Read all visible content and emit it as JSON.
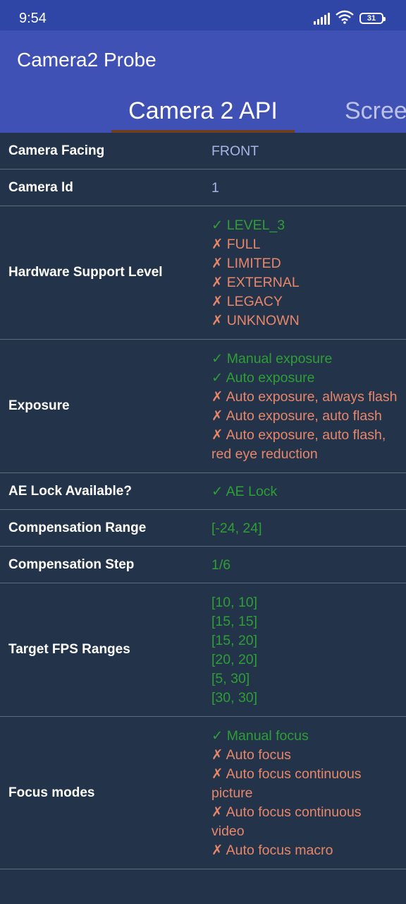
{
  "status_bar": {
    "time": "9:54",
    "battery": "31"
  },
  "app_bar": {
    "title": "Camera2 Probe"
  },
  "tabs": {
    "active": "Camera 2 API",
    "next": "Scree"
  },
  "colors": {
    "status_bar": "#2F46A6",
    "app_bar": "#3F51B5",
    "background": "#23344A",
    "supported": "#2E9E35",
    "unsupported": "#E8866A",
    "neutral_value": "#A8B4E6",
    "tab_indicator": "#6E3E22"
  },
  "rows": [
    {
      "label": "Camera Facing",
      "values": [
        {
          "text": "FRONT",
          "kind": "neutral"
        }
      ]
    },
    {
      "label": "Camera Id",
      "values": [
        {
          "text": "1",
          "kind": "neutral"
        }
      ]
    },
    {
      "label": "Hardware Support Level",
      "values": [
        {
          "text": "✓ LEVEL_3",
          "kind": "ok"
        },
        {
          "text": "✗ FULL",
          "kind": "no"
        },
        {
          "text": "✗ LIMITED",
          "kind": "no"
        },
        {
          "text": "✗ EXTERNAL",
          "kind": "no"
        },
        {
          "text": "✗ LEGACY",
          "kind": "no"
        },
        {
          "text": "✗ UNKNOWN",
          "kind": "no"
        }
      ]
    },
    {
      "label": "Exposure",
      "values": [
        {
          "text": "✓ Manual exposure",
          "kind": "ok"
        },
        {
          "text": "✓ Auto exposure",
          "kind": "ok"
        },
        {
          "text": "✗ Auto exposure, always flash",
          "kind": "no"
        },
        {
          "text": "✗ Auto exposure, auto flash",
          "kind": "no"
        },
        {
          "text": "✗ Auto exposure, auto flash, red eye reduction",
          "kind": "no"
        }
      ]
    },
    {
      "label": "AE Lock Available?",
      "values": [
        {
          "text": "✓ AE Lock",
          "kind": "ok"
        }
      ]
    },
    {
      "label": "Compensation Range",
      "values": [
        {
          "text": "[-24, 24]",
          "kind": "ok"
        }
      ]
    },
    {
      "label": "Compensation Step",
      "values": [
        {
          "text": "1/6",
          "kind": "ok"
        }
      ]
    },
    {
      "label": "Target FPS Ranges",
      "values": [
        {
          "text": "[10, 10]",
          "kind": "ok"
        },
        {
          "text": "[15, 15]",
          "kind": "ok"
        },
        {
          "text": "[15, 20]",
          "kind": "ok"
        },
        {
          "text": "[20, 20]",
          "kind": "ok"
        },
        {
          "text": "[5, 30]",
          "kind": "ok"
        },
        {
          "text": "[30, 30]",
          "kind": "ok"
        }
      ]
    },
    {
      "label": "Focus modes",
      "values": [
        {
          "text": "✓ Manual focus",
          "kind": "ok"
        },
        {
          "text": "✗ Auto focus",
          "kind": "no"
        },
        {
          "text": "✗ Auto focus continuous picture",
          "kind": "no"
        },
        {
          "text": "✗ Auto focus continuous video",
          "kind": "no"
        },
        {
          "text": "✗ Auto focus macro",
          "kind": "no"
        }
      ]
    }
  ]
}
